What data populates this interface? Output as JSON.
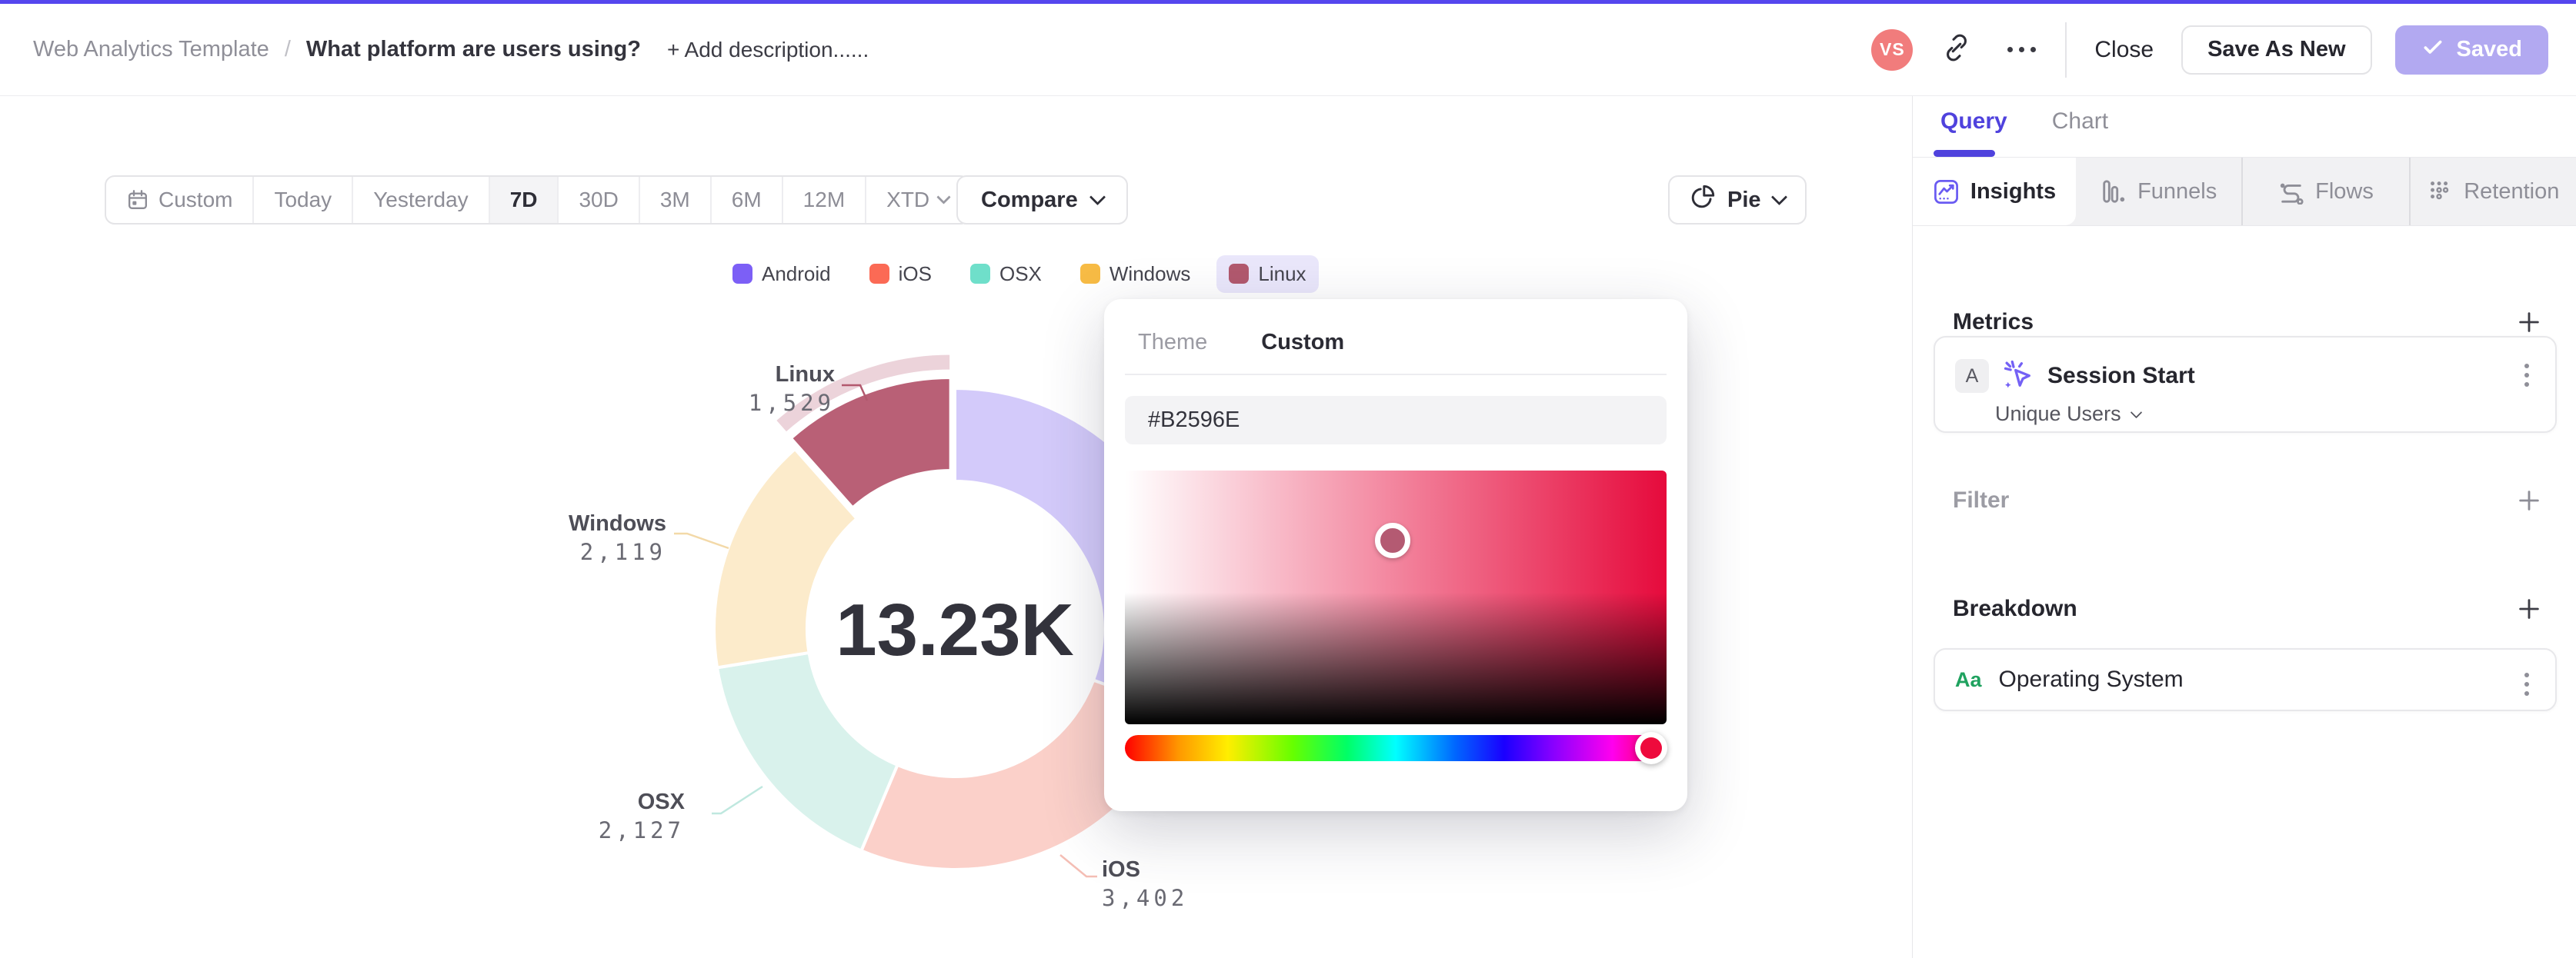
{
  "header": {
    "breadcrumb_root": "Web Analytics Template",
    "breadcrumb_separator": "/",
    "title": "What platform are users using?",
    "add_description_label": "+ Add description......",
    "avatar_initials": "VS",
    "close_label": "Close",
    "save_as_new_label": "Save As New",
    "saved_label": "Saved",
    "accent_color": "#5546ee",
    "saved_button_color": "#b2a9f1",
    "avatar_color": "#f17c7c"
  },
  "toolbar": {
    "ranges": [
      {
        "label": "Custom",
        "icon": "calendar"
      },
      {
        "label": "Today"
      },
      {
        "label": "Yesterday"
      },
      {
        "label": "7D"
      },
      {
        "label": "30D"
      },
      {
        "label": "3M"
      },
      {
        "label": "6M"
      },
      {
        "label": "12M"
      },
      {
        "label": "XTD",
        "chevron": true
      }
    ],
    "selected_range": "7D",
    "compare_label": "Compare",
    "chart_type_label": "Pie"
  },
  "chart_data": {
    "type": "pie",
    "center_total": "13.23K",
    "total_value": 13230,
    "highlighted": "Linux",
    "highlight_band_color": "#ecd3da",
    "legend_position": "top",
    "categories": [
      "Android",
      "iOS",
      "OSX",
      "Windows",
      "Linux"
    ],
    "values": [
      4053,
      3402,
      2127,
      2119,
      1529
    ],
    "slices": [
      {
        "name": "Android",
        "value": 4053,
        "value_label": "",
        "legend_color": "#7c5ff6",
        "slice_color": "#d3cafa",
        "label_visible": false
      },
      {
        "name": "iOS",
        "value": 3402,
        "value_label": "3,402",
        "legend_color": "#fb6a55",
        "slice_color": "#fbd0c9",
        "label_visible": true
      },
      {
        "name": "OSX",
        "value": 2127,
        "value_label": "2,127",
        "legend_color": "#6fdfca",
        "slice_color": "#d9f2ec",
        "label_visible": true
      },
      {
        "name": "Windows",
        "value": 2119,
        "value_label": "2,119",
        "legend_color": "#f7bb45",
        "slice_color": "#fcebcb",
        "label_visible": true
      },
      {
        "name": "Linux",
        "value": 1529,
        "value_label": "1,529",
        "legend_color": "#b2596e",
        "slice_color": "#b96076",
        "label_visible": true
      }
    ]
  },
  "color_picker": {
    "tabs": [
      {
        "label": "Theme",
        "active": false
      },
      {
        "label": "Custom",
        "active": true
      }
    ],
    "hex_value": "#B2596E",
    "gradient_hue_color": "#e60a3c",
    "cursor_fill_color": "#b45a72",
    "hue_handle_color": "#ee0a3c"
  },
  "panel": {
    "tabs": [
      {
        "label": "Query",
        "active": true
      },
      {
        "label": "Chart",
        "active": false
      }
    ],
    "analysis_tabs": [
      {
        "label": "Insights",
        "icon": "insights",
        "active": true
      },
      {
        "label": "Funnels",
        "icon": "funnels",
        "active": false
      },
      {
        "label": "Flows",
        "icon": "flows",
        "active": false
      },
      {
        "label": "Retention",
        "icon": "retention",
        "active": false
      }
    ],
    "metrics": {
      "heading": "Metrics",
      "row_badge": "A",
      "event_name": "Session Start",
      "aggregation_label": "Unique Users"
    },
    "filter": {
      "heading": "Filter"
    },
    "breakdown": {
      "heading": "Breakdown",
      "type_icon_label": "Aa",
      "item_label": "Operating System"
    }
  }
}
